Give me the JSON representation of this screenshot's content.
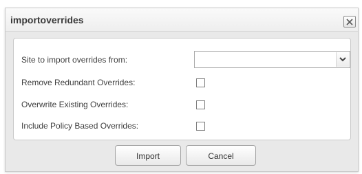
{
  "dialog": {
    "title": "importoverrides",
    "close_icon": "close-x-icon"
  },
  "form": {
    "site_label": "Site to import overrides from:",
    "site_value": "",
    "remove_redundant_label": "Remove Redundant Overrides:",
    "remove_redundant_checked": false,
    "overwrite_existing_label": "Overwrite Existing Overrides:",
    "overwrite_existing_checked": false,
    "include_policy_label": "Include Policy Based Overrides:",
    "include_policy_checked": false
  },
  "buttons": {
    "import_label": "Import",
    "cancel_label": "Cancel"
  }
}
